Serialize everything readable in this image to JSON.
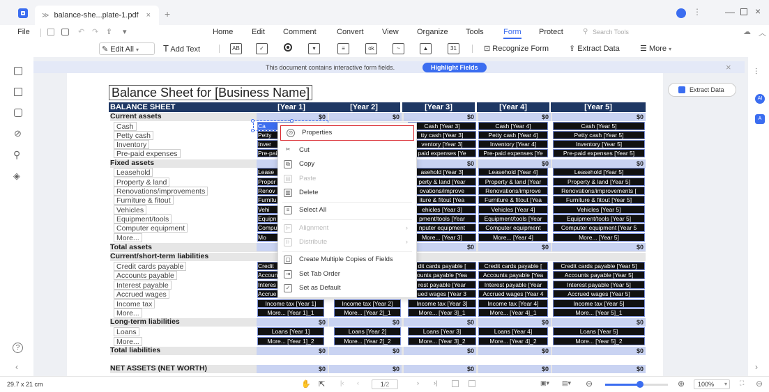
{
  "window": {
    "tab_title": "balance-she...plate-1.pdf",
    "tab_close": "×",
    "new_tab": "+"
  },
  "menu": {
    "file": "File",
    "items": [
      "Home",
      "Edit",
      "Comment",
      "Convert",
      "View",
      "Organize",
      "Tools",
      "Form",
      "Protect"
    ],
    "search_placeholder": "Search Tools"
  },
  "toolbar": {
    "edit_all": "Edit All",
    "add_text": "Add Text",
    "recognize_form": "Recognize Form",
    "extract_data": "Extract Data",
    "more": "More"
  },
  "notice": {
    "text": "This document contains interactive form fields.",
    "button": "Highlight Fields",
    "close": "×"
  },
  "document": {
    "title": "Balance Sheet for [Business Name]",
    "extract_button": "Extract Data",
    "header_label": "BALANCE SHEET",
    "years": [
      "[Year 1]",
      "[Year 2]",
      "[Year 3]",
      "[Year 4]",
      "[Year 5]"
    ],
    "sections": {
      "current_assets": "Current assets",
      "fixed_assets": "Fixed assets",
      "total_assets": "Total assets",
      "current_liabilities": "Current/short-term liabilities",
      "long_term_liabilities": "Long-term liabilities",
      "total_liabilities": "Total liabilities",
      "net_assets": "NET ASSETS (NET WORTH)"
    },
    "rows": {
      "cash": "Cash",
      "petty_cash": "Petty cash",
      "inventory": "Inventory",
      "prepaid": "Pre-paid expenses",
      "leasehold": "Leasehold",
      "property": "Property & land",
      "renovations": "Renovations/improvements",
      "furniture": "Furniture & fitout",
      "vehicles": "Vehicles",
      "equipment": "Equipment/tools",
      "computer": "Computer equipment",
      "more1": "More...",
      "credit_cards": "Credit cards payable",
      "accounts_payable": "Accounts payable",
      "interest_payable": "Interest payable",
      "accrued_wages": "Accrued wages",
      "income_tax": "Income tax",
      "more2": "More...",
      "loans": "Loans",
      "more3": "More..."
    },
    "money": "$0",
    "cells": {
      "y3": [
        "Cash [Year 3]",
        "tty cash [Year 3]",
        "ventory [Year 3]",
        "paid  expenses [Ye",
        "asehold [Year 3]",
        "perty & land [Year",
        "ovations/improve",
        "iture & fitout [Yea",
        "ehicles [Year 3]",
        "pment/tools [Year",
        "nputer equipment",
        "More... [Year 3]",
        "dit cards payable [",
        "ounts payable [Yea",
        "rest payable [Year",
        "ued wages [Year 3",
        "Income tax [Year 3]",
        "More... [Year 3]_1",
        "Loans [Year 3]",
        "More... [Year 3]_2"
      ],
      "y4": [
        "Cash [Year 4]",
        "Petty cash [Year 4]",
        "Inventory [Year 4]",
        "Pre-paid  expenses [Ye",
        "Leasehold [Year 4]",
        "Property & land [Year",
        "Renovations/improve",
        "Furniture & fitout [Yea",
        "Vehicles [Year 4]",
        "Equipment/tools [Year",
        "Computer equipment",
        "More... [Year 4]",
        "Credit cards payable [",
        "Accounts payable [Yea",
        "Interest payable [Year",
        "Accrued wages [Year 4",
        "Income tax [Year 4]",
        "More... [Year 4]_1",
        "Loans [Year 4]",
        "More... [Year 4]_2"
      ],
      "y5": [
        "Cash [Year 5]",
        "Petty cash [Year 5]",
        "Inventory [Year 5]",
        "Pre-paid expenses [Year 5]",
        "Leasehold [Year 5]",
        "Property & land [Year 5]",
        "Renovations/improvements [",
        "Furniture & fitout [Year 5]",
        "Vehicles [Year 5]",
        "Equipment/tools [Year 5]",
        "Computer  equipment  [Year 5",
        "More... [Year 5]",
        "Credit cards payable [Year 5]",
        "Accounts payable [Year 5]",
        "Interest payable [Year 5]",
        "Accrued wages [Year 5]",
        "Income tax [Year 5]",
        "More... [Year 5]_1",
        "Loans [Year 5]",
        "More... [Year 5]_2"
      ],
      "y1": [
        "Ca",
        "Petty",
        "Inver",
        "Pre-pai",
        "Lease",
        "Proper",
        "Renov",
        "Furnitu",
        "Vehi",
        "Equipn",
        "Compu",
        "Mo",
        "Credit",
        "Accoun",
        "Interes",
        "Accrue",
        "Income tax [Year 1]",
        "More... [Year 1]_1",
        "Loans [Year 1]",
        "More... [Year 1]_2"
      ],
      "y2": [
        "",
        "",
        "",
        "",
        "",
        "",
        "",
        "",
        "",
        "",
        "",
        "",
        "",
        "",
        "",
        "",
        "Income tax [Year 2]",
        "More... [Year 2]_1",
        "Loans [Year 2]",
        "More... [Year 2]_2"
      ]
    }
  },
  "context_menu": {
    "properties": "Properties",
    "cut": "Cut",
    "copy": "Copy",
    "paste": "Paste",
    "delete": "Delete",
    "select_all": "Select All",
    "alignment": "Alignment",
    "distribute": "Distribute",
    "create_copies": "Create Multiple Copies of Fields",
    "set_tab_order": "Set Tab Order",
    "set_default": "Set as Default"
  },
  "status": {
    "page_size": "29.7 x 21 cm",
    "page_num": "1",
    "page_total": "/2",
    "zoom": "100%",
    "zoom_level": 0.55
  },
  "colors": {
    "accent": "#3b6df0",
    "header_bg": "#1f3864",
    "field_bg": "#111111",
    "field_border": "#7a8fd9",
    "money_bg": "#c9d3f2",
    "highlight_border": "#d9262c"
  }
}
